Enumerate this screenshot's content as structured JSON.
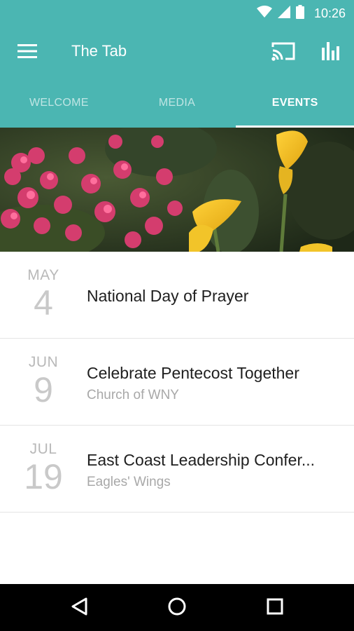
{
  "status_bar": {
    "time": "10:26",
    "icons": [
      "wifi-icon",
      "signal-icon",
      "battery-icon"
    ]
  },
  "app_bar": {
    "title": "The Tab",
    "icons": [
      "menu-icon",
      "cast-icon",
      "bar-chart-icon"
    ]
  },
  "tabs": [
    {
      "label": "WELCOME",
      "active": false
    },
    {
      "label": "MEDIA",
      "active": false
    },
    {
      "label": "EVENTS",
      "active": true
    }
  ],
  "events": [
    {
      "month": "MAY",
      "day": "4",
      "title": "National Day of Prayer",
      "subtitle": ""
    },
    {
      "month": "JUN",
      "day": "9",
      "title": "Celebrate Pentecost Together",
      "subtitle": "Church of WNY"
    },
    {
      "month": "JUL",
      "day": "19",
      "title": "East Coast Leadership Confer...",
      "subtitle": "Eagles' Wings"
    }
  ],
  "nav_bar": {
    "icons": [
      "back-icon",
      "home-icon",
      "recents-icon"
    ]
  },
  "colors": {
    "primary": "#4bb6b2",
    "tab_indicator": "#ffffff",
    "title_text": "#1f1f1f",
    "muted_text": "#a8a8a8"
  }
}
